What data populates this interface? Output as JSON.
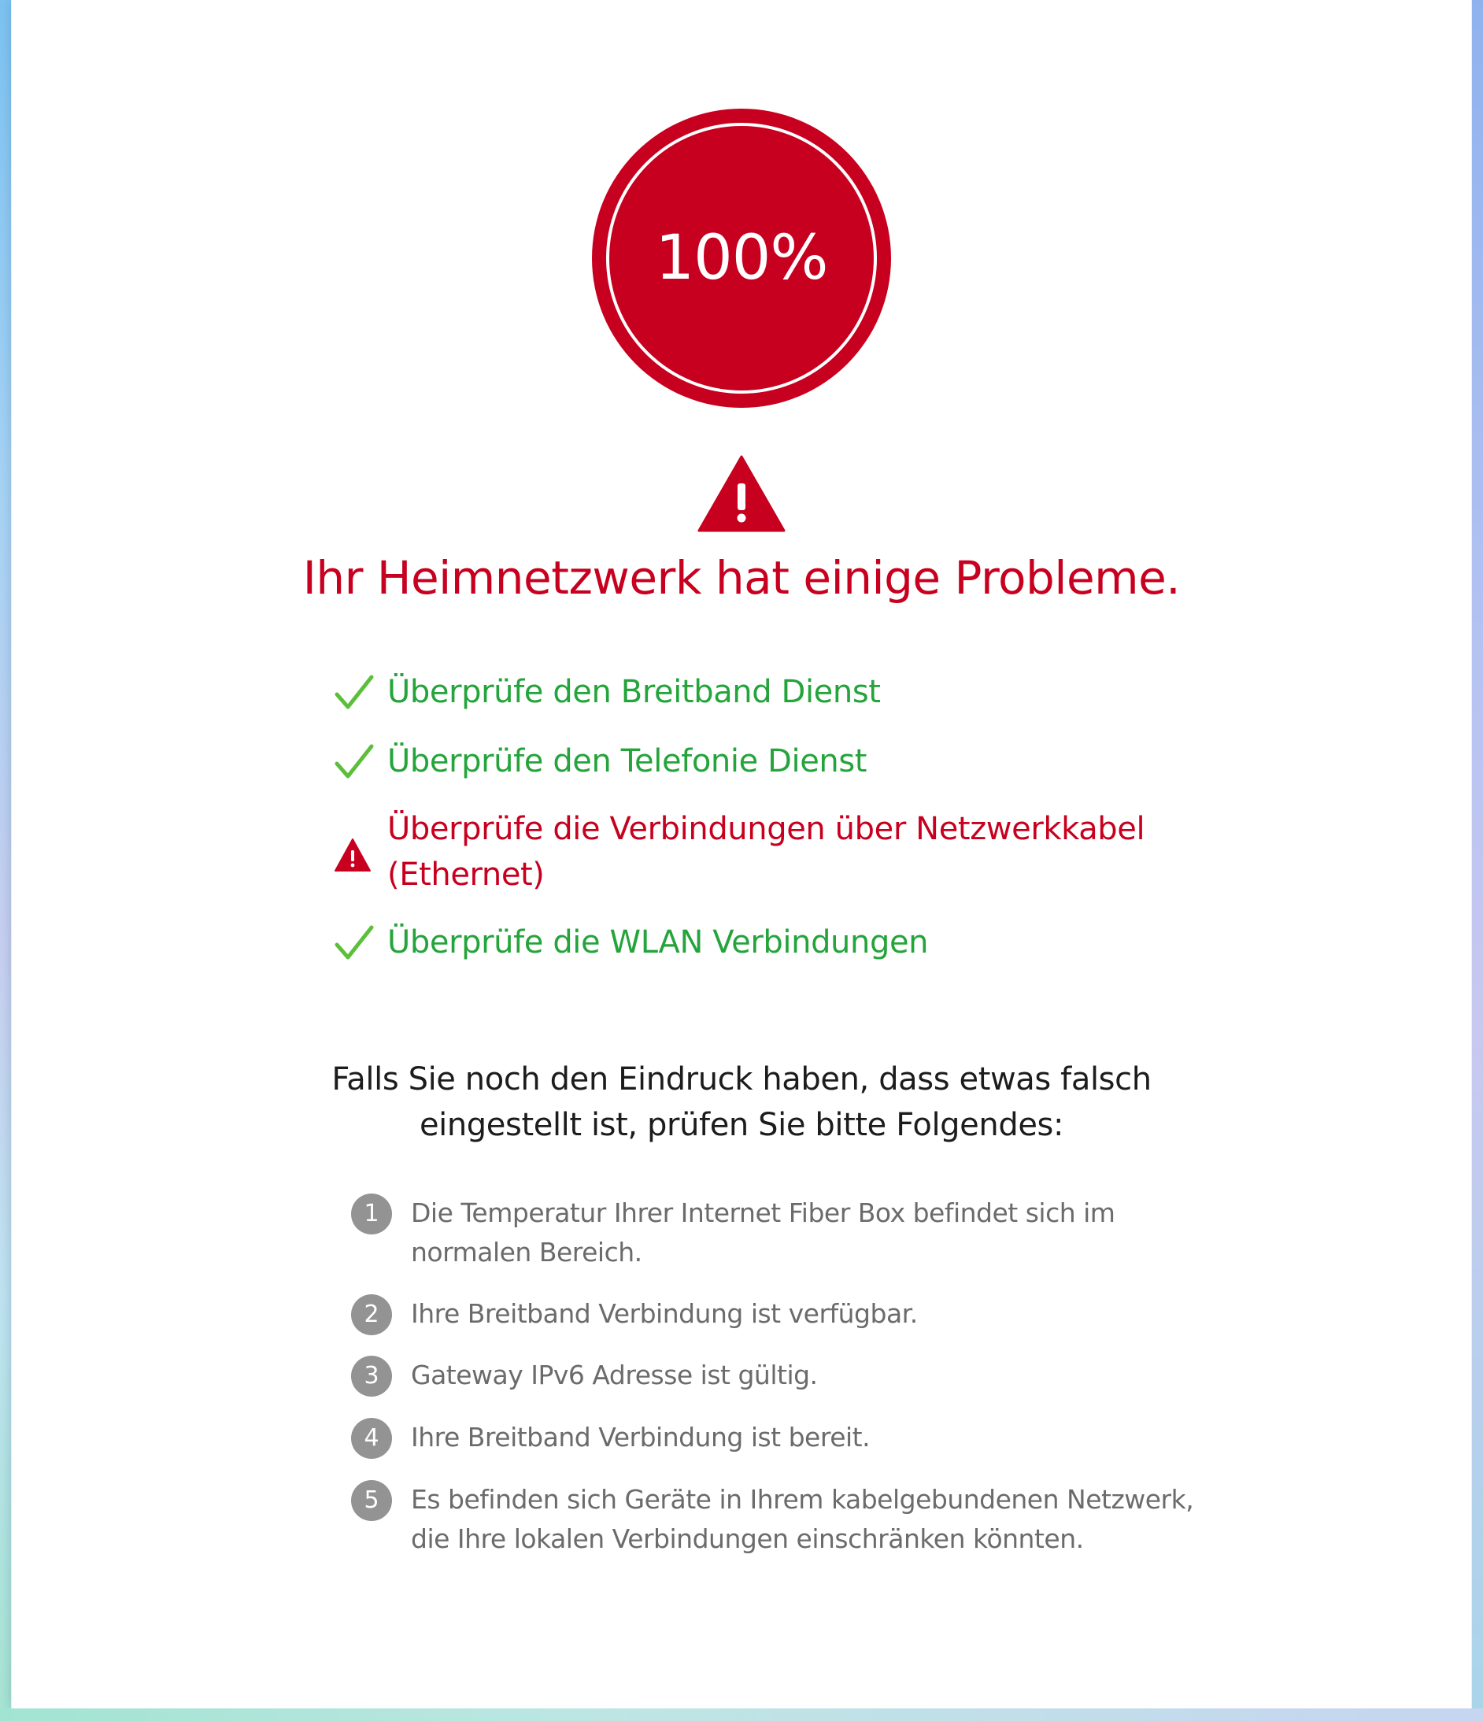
{
  "progress": {
    "value_text": "100%",
    "fraction": 1.0,
    "color": "#c8001f"
  },
  "status": {
    "icon": "warning-triangle-icon",
    "headline": "Ihr Heimnetzwerk hat einige Probleme."
  },
  "checks": [
    {
      "label": "Überprüfe den Breitband Dienst",
      "state": "ok",
      "icon": "checkmark-icon"
    },
    {
      "label": "Überprüfe den Telefonie Dienst",
      "state": "ok",
      "icon": "checkmark-icon"
    },
    {
      "label": "Überprüfe die Verbindungen über Netzwerkkabel (Ethernet)",
      "state": "error",
      "icon": "warning-triangle-icon"
    },
    {
      "label": "Überprüfe die WLAN Verbindungen",
      "state": "ok",
      "icon": "checkmark-icon"
    }
  ],
  "intro": {
    "line1": "Falls Sie noch den Eindruck haben, dass etwas falsch",
    "line2": "eingestellt ist, prüfen Sie bitte Folgendes:"
  },
  "steps": [
    {
      "number": "1",
      "text": "Die Temperatur Ihrer Internet Fiber Box befindet sich im normalen Bereich."
    },
    {
      "number": "2",
      "text": "Ihre Breitband Verbindung ist verfügbar."
    },
    {
      "number": "3",
      "text": "Gateway IPv6 Adresse ist gültig."
    },
    {
      "number": "4",
      "text": "Ihre Breitband Verbindung ist bereit."
    },
    {
      "number": "5",
      "text": "Es befinden sich Geräte in Ihrem kabelgebundenen Netzwerk, die Ihre lokalen Verbindungen einschränken könnten."
    }
  ],
  "colors": {
    "ok": "#24a43b",
    "error": "#c8001f",
    "step_badge": "#939393",
    "step_text": "#6b6b6b"
  }
}
